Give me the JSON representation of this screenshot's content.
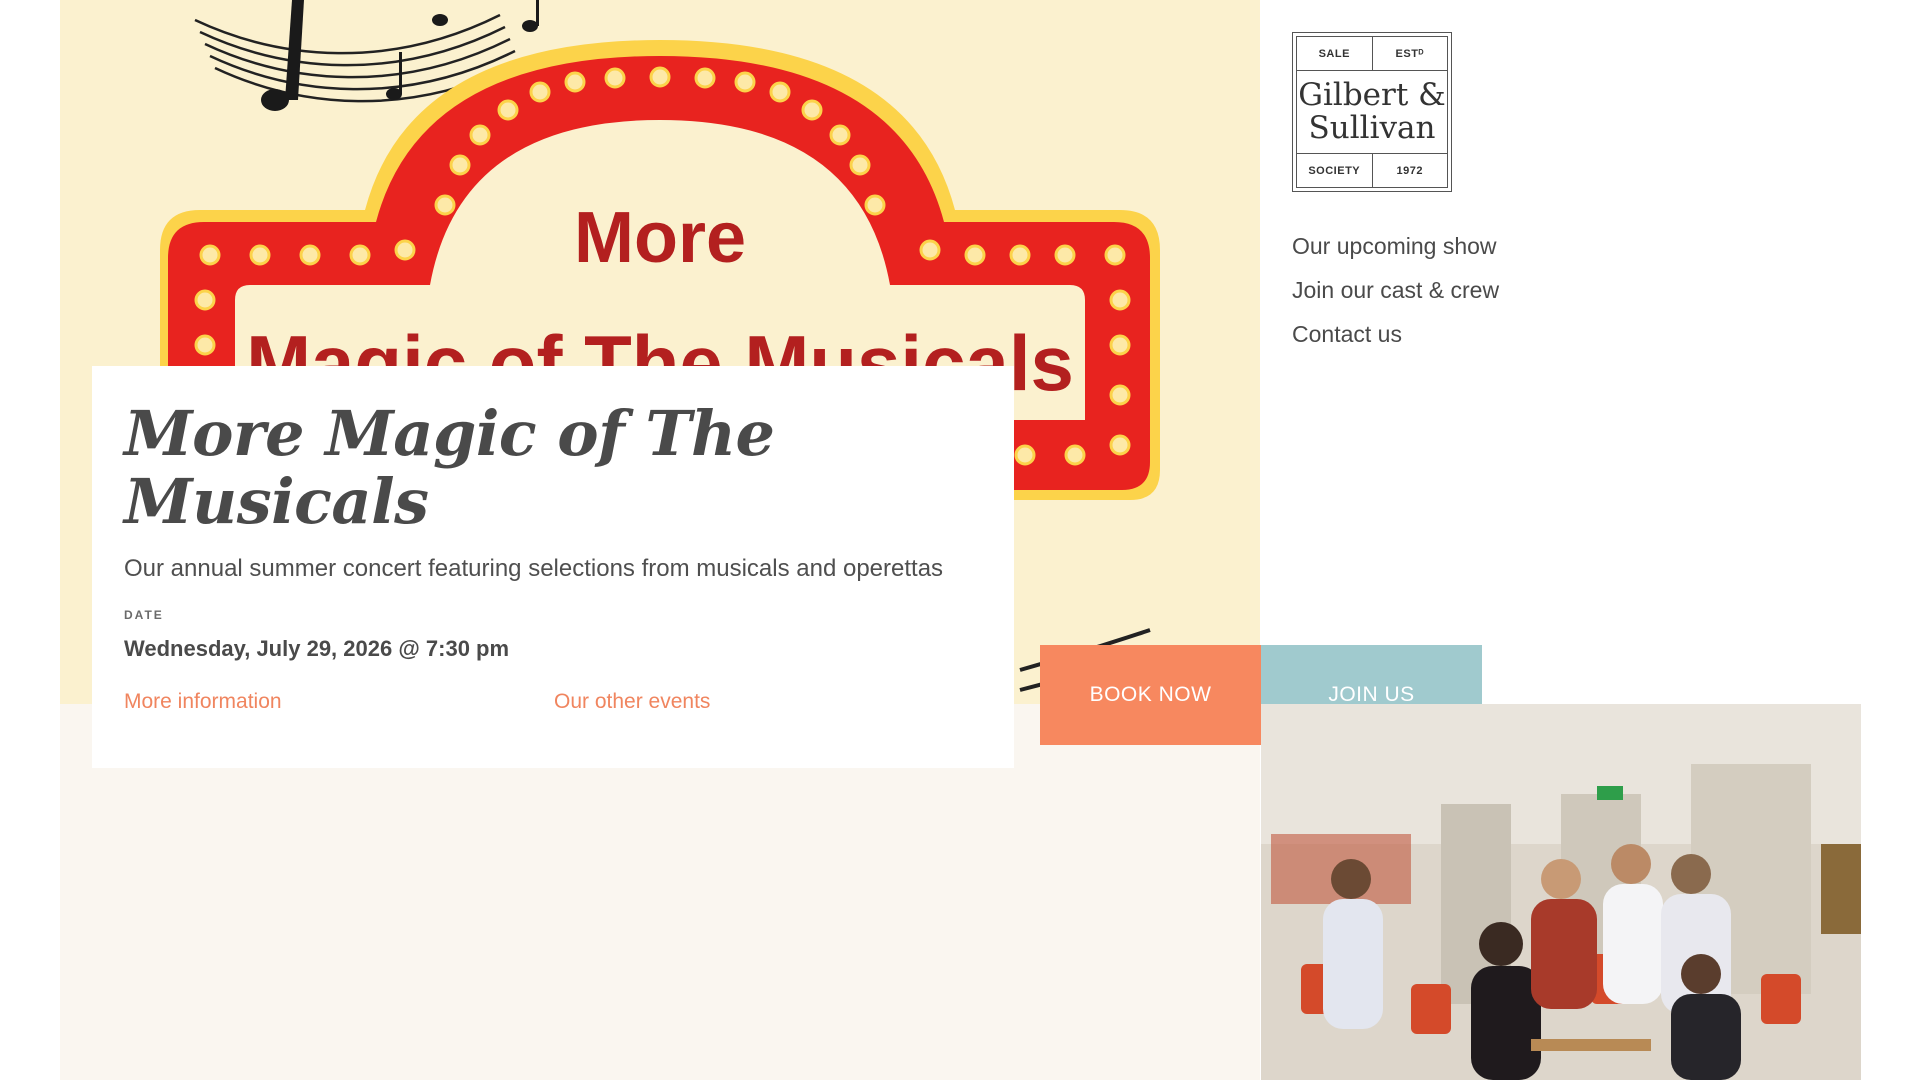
{
  "hero": {
    "marquee_line1": "More",
    "marquee_line2": "Magic of The Musicals"
  },
  "event": {
    "title": "More Magic of The Musicals",
    "subtitle": "Our annual summer concert featuring selections from musicals and operettas",
    "date_label": "DATE",
    "date_value": "Wednesday, July 29, 2026 @ 7:30 pm",
    "link_more": "More information",
    "link_other": "Our other events"
  },
  "logo": {
    "top_left": "SALE",
    "top_right": "ESTᴰ",
    "name_line1": "Gilbert &",
    "name_line2": "Sullivan",
    "bottom_left": "SOCIETY",
    "bottom_right": "1972"
  },
  "nav": {
    "items": [
      {
        "label": "Our upcoming show"
      },
      {
        "label": "Join our cast & crew"
      },
      {
        "label": "Contact us"
      }
    ]
  },
  "buttons": {
    "book": "BOOK NOW",
    "join": "JOIN US"
  },
  "colors": {
    "hero_bg": "#fbf1cf",
    "cream_bg": "#faf6f0",
    "accent_orange": "#f7885f",
    "accent_teal": "#a0cace",
    "marquee_red": "#e8231f",
    "marquee_gold": "#fcd34a",
    "text_dark": "#4a4a4a"
  }
}
